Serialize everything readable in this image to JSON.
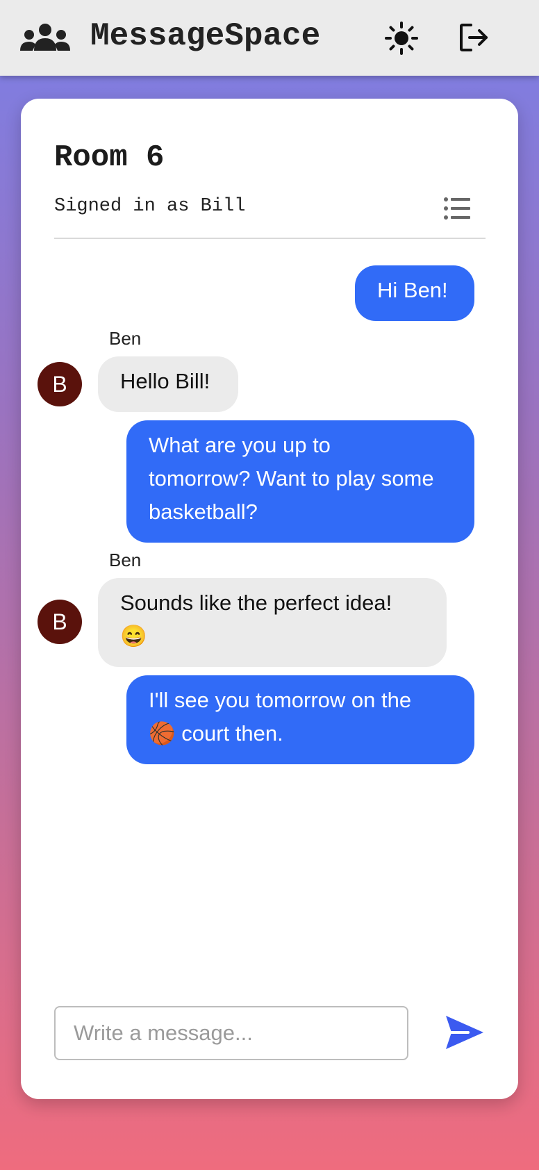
{
  "header": {
    "app_title": "MessageSpace",
    "logo_icon": "users-group-icon",
    "theme_icon": "sun-icon",
    "logout_icon": "logout-icon"
  },
  "room": {
    "title": "Room 6",
    "signed_in": "Signed in as Bill",
    "menu_icon": "list-icon"
  },
  "messages": [
    {
      "from": "me",
      "text": "Hi Ben!"
    },
    {
      "from": "Ben",
      "avatar": "B",
      "text": "Hello Bill!"
    },
    {
      "from": "me",
      "text_lines": [
        "What are you up to",
        "tomorrow? Want to play some",
        "basketball?"
      ]
    },
    {
      "from": "Ben",
      "avatar": "B",
      "text_lines": [
        "Sounds like the perfect idea!",
        "😄"
      ]
    },
    {
      "from": "me",
      "text_lines": [
        "I'll see you tomorrow on the",
        "🏀 court then."
      ]
    }
  ],
  "composer": {
    "placeholder": "Write a message...",
    "send_icon": "send-icon"
  },
  "colors": {
    "outgoing_bubble": "#316bf7",
    "incoming_bubble": "#ebebeb",
    "avatar_bg": "#5a120c",
    "send_icon": "#3b5af0"
  }
}
